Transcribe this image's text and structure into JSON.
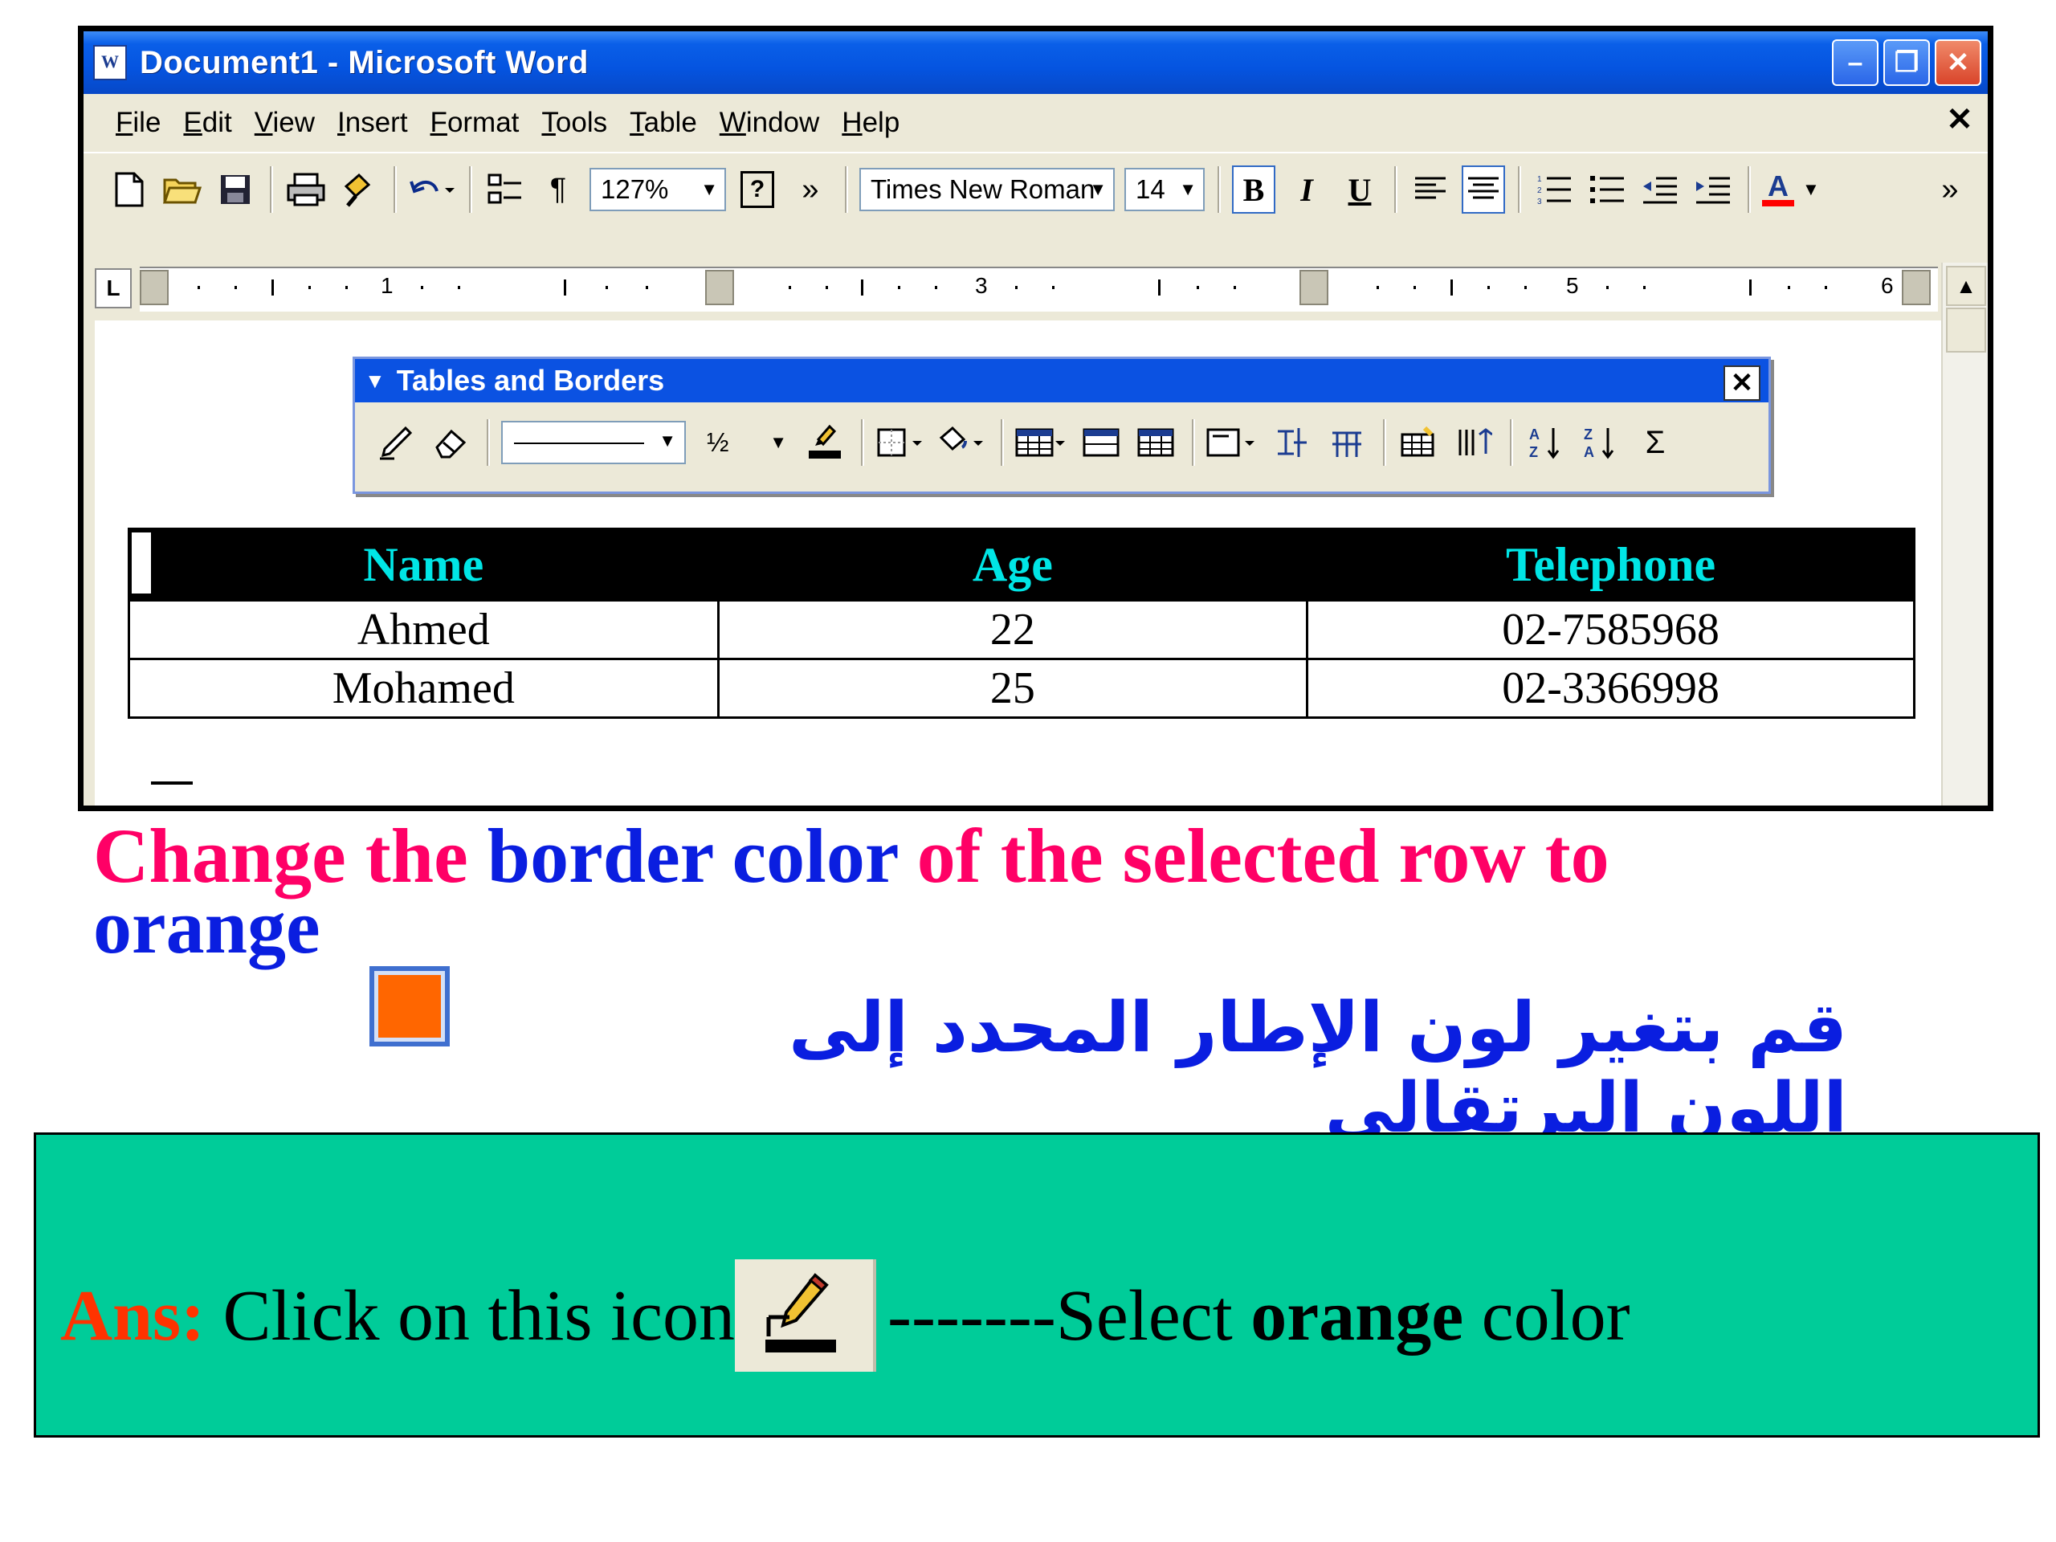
{
  "window": {
    "title": "Document1 - Microsoft Word",
    "minimize": "–",
    "restore": "❐",
    "close": "✕",
    "doc_close": "✕"
  },
  "menu": [
    "File",
    "Edit",
    "View",
    "Insert",
    "Format",
    "Tools",
    "Table",
    "Window",
    "Help"
  ],
  "toolbar": {
    "zoom": "127%",
    "font": "Times New Roman",
    "size": "14",
    "bold": "B",
    "italic": "I",
    "underline": "U",
    "more": "»",
    "font_color_letter": "A",
    "pilcrow": "¶",
    "help": "?"
  },
  "ruler": {
    "numbers": [
      "1",
      "3",
      "5",
      "6"
    ]
  },
  "tables_borders": {
    "title": "Tables and Borders",
    "close": "✕",
    "line_weight": "½",
    "sum": "Σ"
  },
  "table": {
    "headers": [
      "Name",
      "Age",
      "Telephone"
    ],
    "rows": [
      [
        "Ahmed",
        "22",
        "02-7585968"
      ],
      [
        "Mohamed",
        "25",
        "02-3366998"
      ]
    ]
  },
  "instruction": {
    "part1": "Change the ",
    "part2": "border color",
    "part3": " of the selected row to ",
    "part4": "orange",
    "arabic": "قم بتغير لون الإطار المحدد إلى اللون البرتقالى"
  },
  "answer": {
    "label": "Ans:",
    "text1": " Click on this icon",
    "text2": "-------Select ",
    "bold": "orange",
    "text3": " color"
  },
  "colors": {
    "title_bar": "#0554e0",
    "header_text": "#00e5e5",
    "instruction_pink": "#ff0066",
    "instruction_blue": "#0a1ee0",
    "swatch_orange": "#ff6600",
    "answer_bg": "#00cc99",
    "answer_label": "#ff3300"
  }
}
